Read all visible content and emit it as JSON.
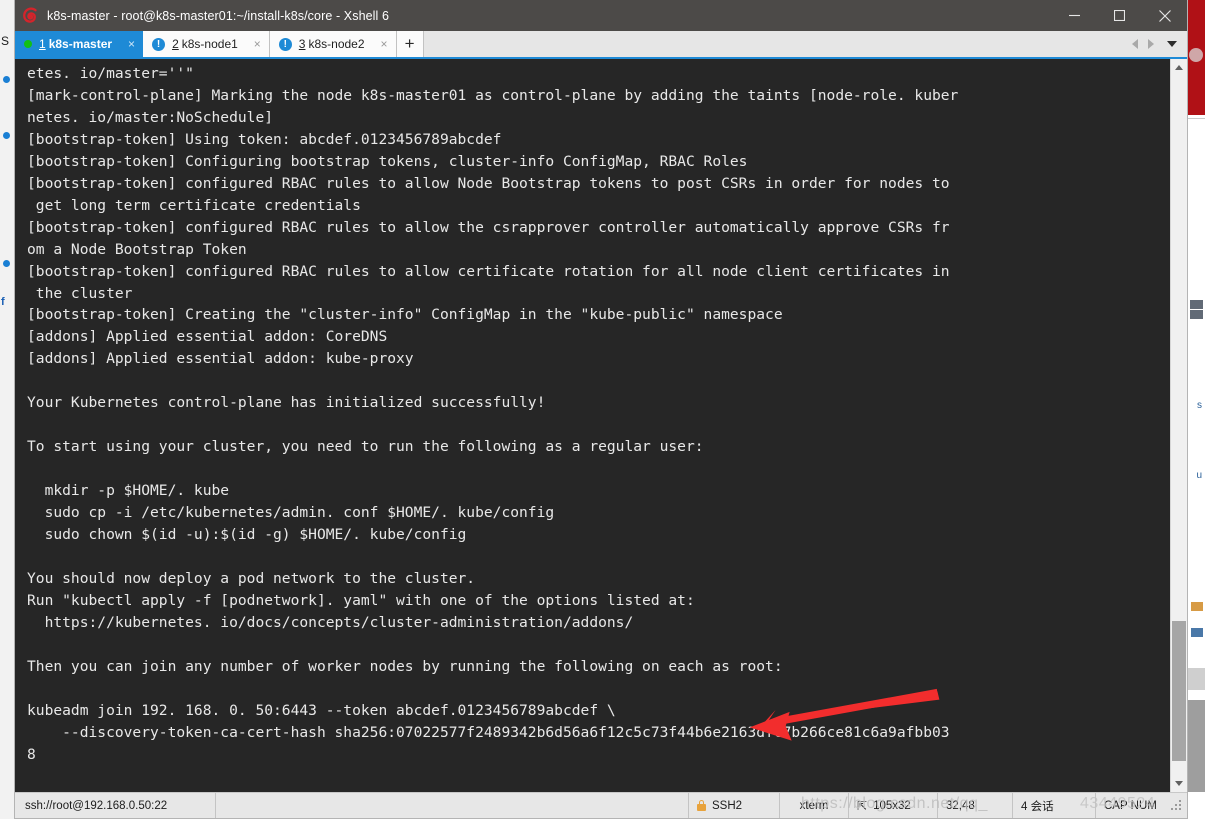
{
  "window": {
    "title": "k8s-master - root@k8s-master01:~/install-k8s/core - Xshell 6",
    "logo_icon": "xshell-logo-icon",
    "minimize_label": "Minimize",
    "maximize_label": "Maximize",
    "close_label": "Close"
  },
  "tabs": {
    "items": [
      {
        "num": "1",
        "label": "k8s-master",
        "status_icon": "green-dot-icon",
        "active": true,
        "close_label": "×"
      },
      {
        "num": "2",
        "label": "k8s-node1",
        "status_icon": "info-badge-icon",
        "active": false,
        "close_label": "×"
      },
      {
        "num": "3",
        "label": "k8s-node2",
        "status_icon": "info-badge-icon",
        "active": false,
        "close_label": "×"
      }
    ],
    "add_label": "+",
    "nav_prev_icon": "triangle-left-icon",
    "nav_next_icon": "triangle-right-icon",
    "nav_menu_icon": "triangle-down-icon"
  },
  "terminal": {
    "lines": "etes. io/master=''\"\n[mark-control-plane] Marking the node k8s-master01 as control-plane by adding the taints [node-role. kuber\nnetes. io/master:NoSchedule]\n[bootstrap-token] Using token: abcdef.0123456789abcdef\n[bootstrap-token] Configuring bootstrap tokens, cluster-info ConfigMap, RBAC Roles\n[bootstrap-token] configured RBAC rules to allow Node Bootstrap tokens to post CSRs in order for nodes to\n get long term certificate credentials\n[bootstrap-token] configured RBAC rules to allow the csrapprover controller automatically approve CSRs fr\nom a Node Bootstrap Token\n[bootstrap-token] configured RBAC rules to allow certificate rotation for all node client certificates in\n the cluster\n[bootstrap-token] Creating the \"cluster-info\" ConfigMap in the \"kube-public\" namespace\n[addons] Applied essential addon: CoreDNS\n[addons] Applied essential addon: kube-proxy\n\nYour Kubernetes control-plane has initialized successfully!\n\nTo start using your cluster, you need to run the following as a regular user:\n\n  mkdir -p $HOME/. kube\n  sudo cp -i /etc/kubernetes/admin. conf $HOME/. kube/config\n  sudo chown $(id -u):$(id -g) $HOME/. kube/config\n\nYou should now deploy a pod network to the cluster.\nRun \"kubectl apply -f [podnetwork]. yaml\" with one of the options listed at:\n  https://kubernetes. io/docs/concepts/cluster-administration/addons/\n\nThen you can join any number of worker nodes by running the following on each as root:\n\nkubeadm join 192. 168. 0. 50:6443 --token abcdef.0123456789abcdef \\\n    --discovery-token-ca-cert-hash sha256:07022577f2489342b6d56a6f12c5c73f44b6e2163dfc7b266ce81c6a9afbb03\n8",
    "background_color": "#262626",
    "foreground_color": "#e8e8e8"
  },
  "annotation": {
    "arrow_icon": "red-arrow-left-icon",
    "arrow_color": "#f22d2d"
  },
  "scrollbar": {
    "up_icon": "chevron-up-icon",
    "down_icon": "chevron-down-icon",
    "thumb_top_percent": 78,
    "thumb_height_percent": 20
  },
  "statusbar": {
    "url": "ssh://root@192.168.0.50:22",
    "security": "SSH2",
    "security_icon": "lock-icon",
    "terminal_type": "xterm",
    "size": "105x32",
    "size_icon": "resize-icon",
    "cursor": "32,48",
    "sessions": "4 会话",
    "caps": "CAP NUM",
    "grip_icon": "resize-grip-icon"
  },
  "watermark": {
    "line1": "https://blog.csdn.net/qq_",
    "line2": "43449524"
  }
}
